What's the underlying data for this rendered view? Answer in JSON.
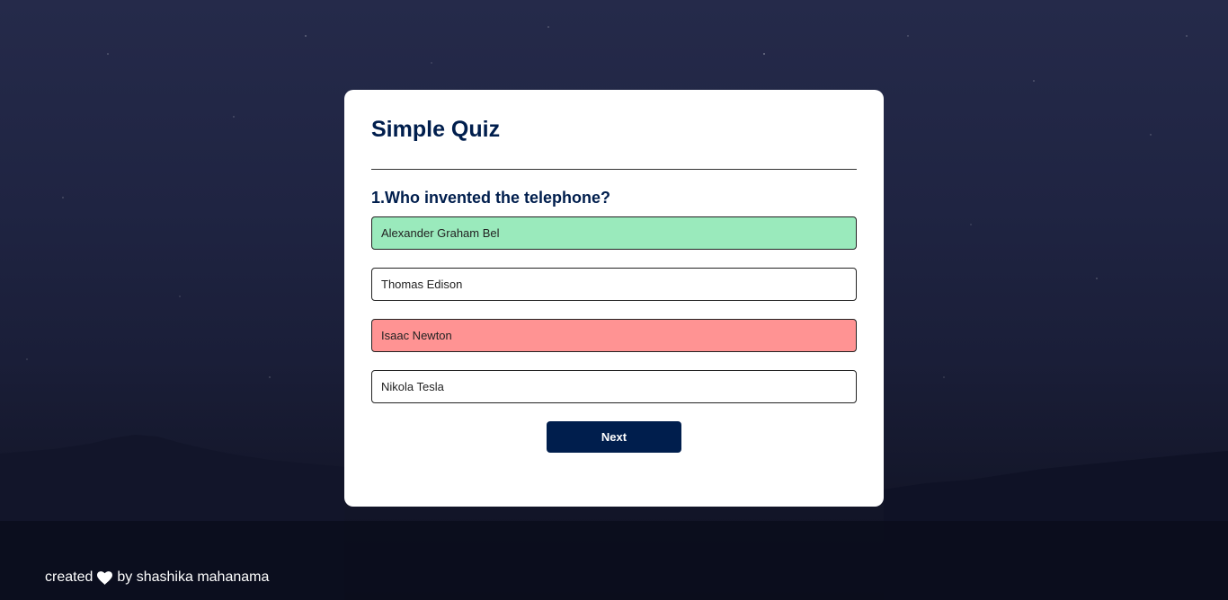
{
  "quiz": {
    "title": "Simple Quiz",
    "question": "1.Who invented the telephone?",
    "answers": [
      {
        "label": "Alexander Graham Bel",
        "state": "correct"
      },
      {
        "label": "Thomas Edison",
        "state": "neutral"
      },
      {
        "label": "Isaac Newton",
        "state": "incorrect"
      },
      {
        "label": "Nikola Tesla",
        "state": "neutral"
      }
    ],
    "next_label": "Next"
  },
  "footer": {
    "prefix": "created",
    "icon": "heart-icon",
    "suffix": "by shashika mahanama"
  },
  "colors": {
    "primary": "#001e4d",
    "correct": "#9aeabc",
    "incorrect": "#ff9393",
    "card": "#ffffff"
  }
}
